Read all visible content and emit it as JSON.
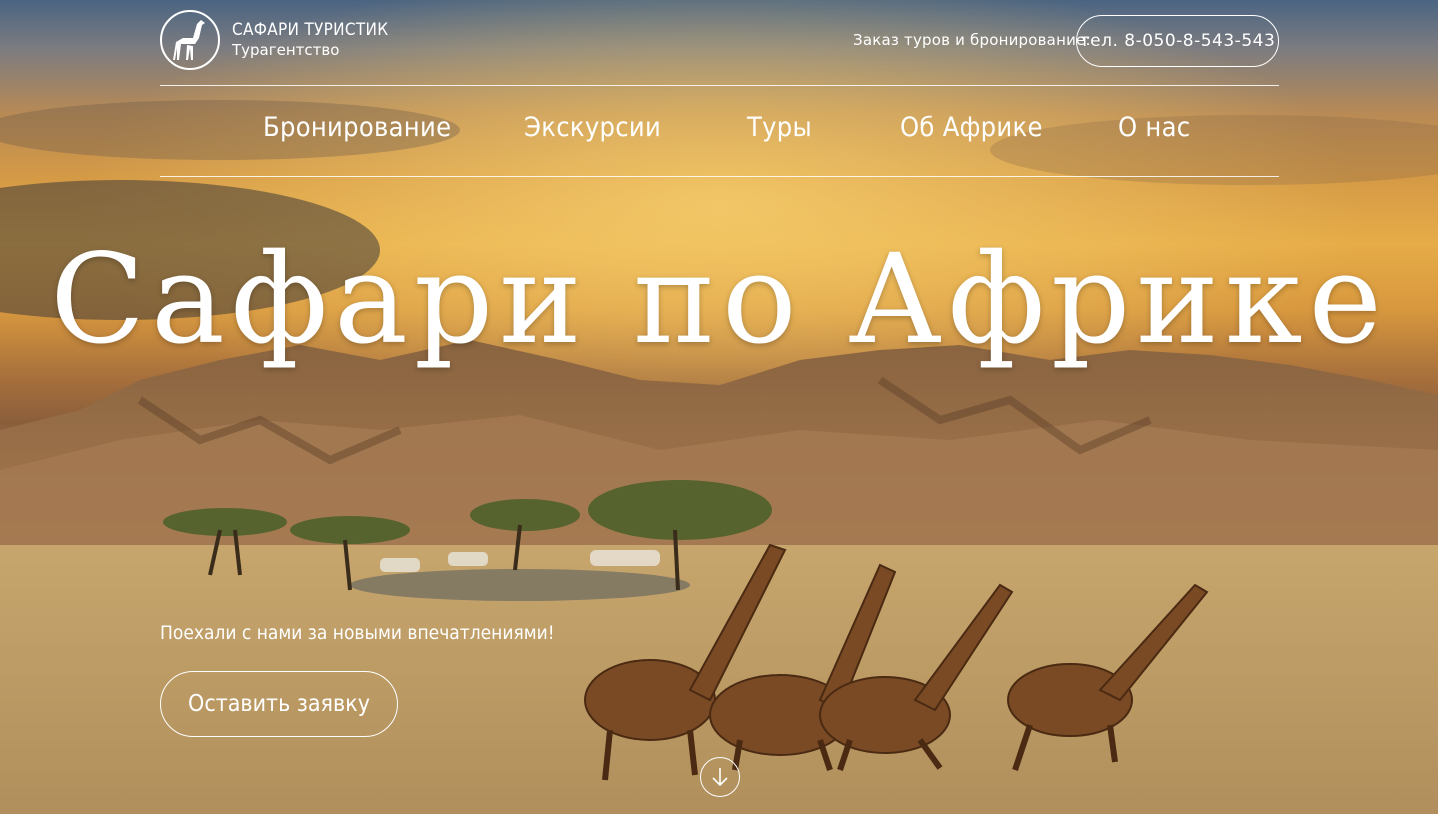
{
  "header": {
    "logo_title": "САФАРИ ТУРИСТИК",
    "logo_subtitle": "Турагентство",
    "logo_icon": "giraffe-icon",
    "order_label": "Заказ туров и бронирование:",
    "phone": "тел. 8-050-8-543-543"
  },
  "nav": {
    "items": [
      {
        "label": "Бронирование"
      },
      {
        "label": "Экскурсии"
      },
      {
        "label": "Туры"
      },
      {
        "label": "Об Африке"
      },
      {
        "label": "О нас"
      }
    ]
  },
  "hero": {
    "headline": "Сафари по Африке",
    "tagline": "Поехали с нами за новыми впечатлениями!",
    "cta_label": "Оставить заявку",
    "scroll_icon": "arrow-down-icon"
  },
  "colors": {
    "text": "#ffffff",
    "sky_top": "#4a6482",
    "sunset": "#e6ac48",
    "savanna": "#c9a870"
  }
}
